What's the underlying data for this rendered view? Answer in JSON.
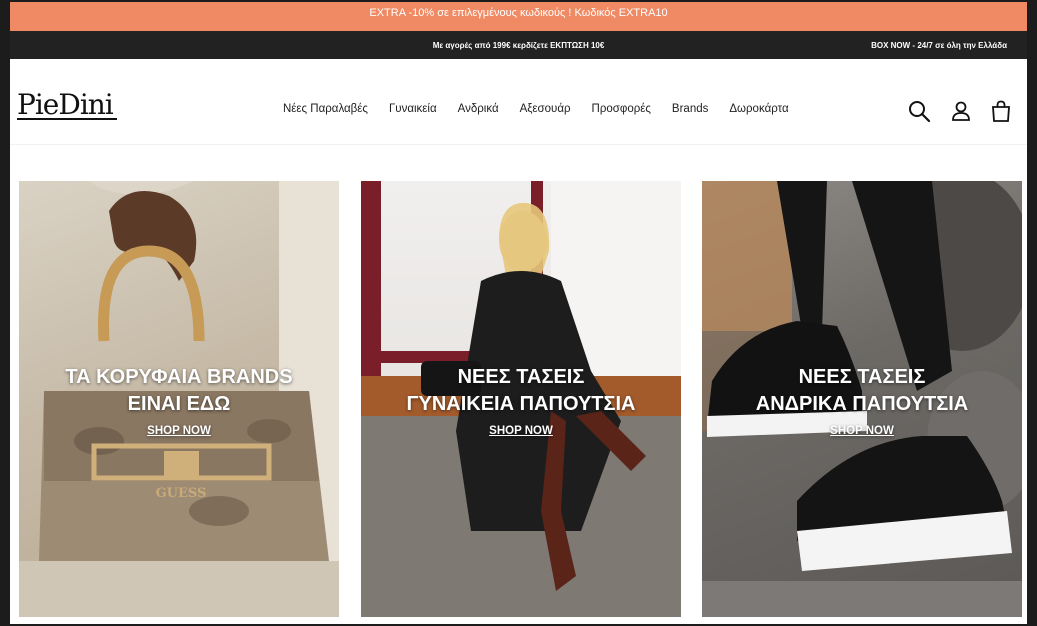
{
  "promo_bar": {
    "text": "EXTRA -10% σε επιλεγμένους κωδικούς ! Κωδικός EXTRA10"
  },
  "info_bar": {
    "center": "Με αγορές από 199€ κερδίζετε ΕΚΠΤΩΣΗ 10€",
    "right": "BOX NOW - 24/7 σε όλη την Ελλάδα"
  },
  "header": {
    "logo": "PieDini",
    "nav": [
      "Νέες Παραλαβές",
      "Γυναικεία",
      "Ανδρικά",
      "Αξεσουάρ",
      "Προσφορές",
      "Brands",
      "Δωροκάρτα"
    ],
    "icons": [
      "search-icon",
      "user-icon",
      "bag-icon"
    ]
  },
  "panels": [
    {
      "title_line1": "ΤΑ ΚΟΡΥΦΑΙΑ BRANDS",
      "title_line2": "ΕΙΝΑΙ ΕΔΩ",
      "cta": "SHOP NOW",
      "bag_brand": "GUESS"
    },
    {
      "title_line1": "ΝΕΕΣ ΤΑΣΕΙΣ",
      "title_line2": "ΓΥΝΑΙΚΕΙΑ ΠΑΠΟΥΤΣΙΑ",
      "cta": "SHOP NOW"
    },
    {
      "title_line1": "ΝΕΕΣ ΤΑΣΕΙΣ",
      "title_line2": "ΑΝΔΡΙΚΑ ΠΑΠΟΥΤΣΙΑ",
      "cta": "SHOP NOW"
    }
  ],
  "colors": {
    "promo": "#ef8a64",
    "info_bar": "#222222",
    "frame": "#1c1c1c"
  }
}
